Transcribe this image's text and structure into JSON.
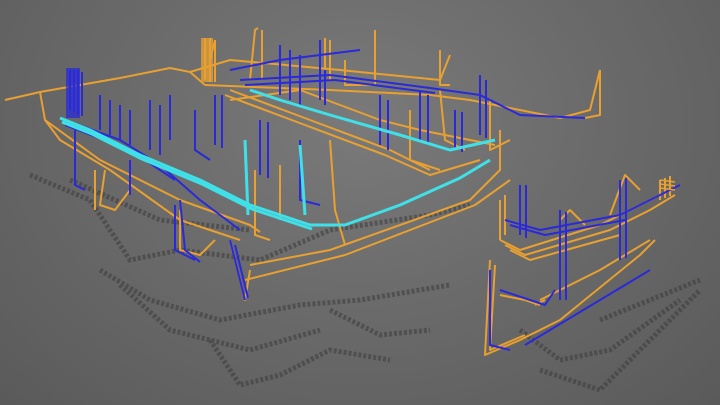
{
  "scene": {
    "background_color": "#6e6e6e",
    "shadow_color": "#3c3c3c",
    "pipe_colors": {
      "orange": "#e8a030",
      "blue": "#2a2ad8",
      "cyan": "#40e0e8"
    }
  }
}
